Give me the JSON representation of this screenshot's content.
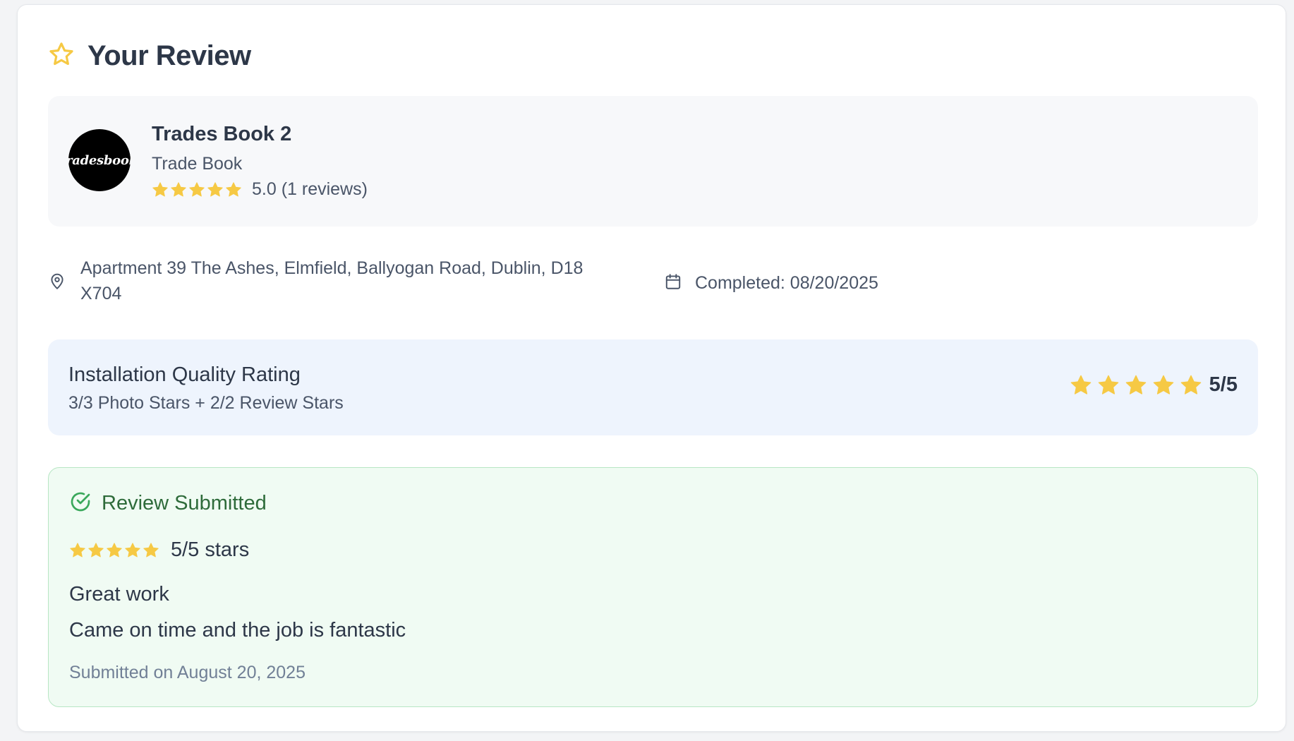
{
  "colors": {
    "star": "#f6c944",
    "success": "#3aa85b",
    "quality_bg": "#eef4fd",
    "submitted_bg": "#f0fbf3"
  },
  "header": {
    "title": "Your Review",
    "icon": "star-outline-icon"
  },
  "company": {
    "logo_text": "Tradesbook.",
    "name": "Trades Book 2",
    "type": "Trade Book",
    "rating": 5,
    "rating_text": "5.0 (1 reviews)"
  },
  "job": {
    "address": "Apartment 39 The Ashes, Elmfield, Ballyogan Road, Dublin, D18 X704",
    "completed": "Completed: 08/20/2025"
  },
  "quality": {
    "title": "Installation Quality Rating",
    "subtitle": "3/3 Photo Stars + 2/2 Review Stars",
    "stars": 5,
    "score": "5/5"
  },
  "review": {
    "status": "Review Submitted",
    "stars": 5,
    "stars_text": "5/5 stars",
    "title": "Great work",
    "body": "Came on time and the job is fantastic",
    "submitted": "Submitted on August 20, 2025"
  }
}
